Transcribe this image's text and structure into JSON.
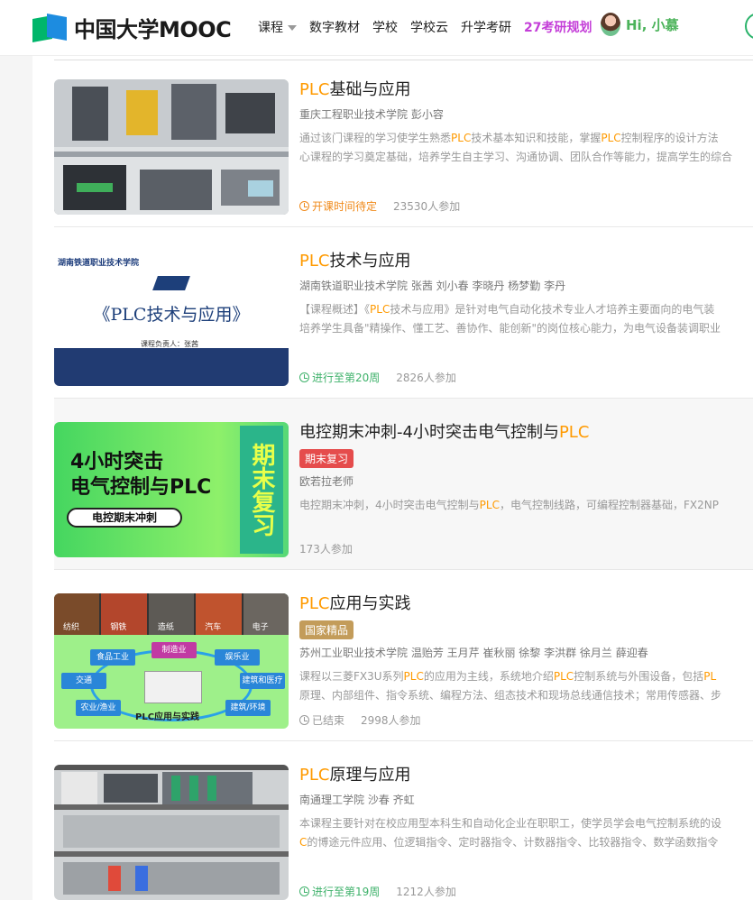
{
  "header": {
    "logo_text": "中国大学MOOC",
    "nav": [
      "课程",
      "数字教材",
      "学校",
      "学校云",
      "升学考研",
      "27考研规划"
    ],
    "greeting": "Hi, 小慕"
  },
  "courses": [
    {
      "title_hl": "PLC",
      "title_rest": "基础与应用",
      "tag": "",
      "school": "重庆工程职业技术学院   彭小容",
      "desc_line1": [
        "通过该门课程的学习使学生熟悉",
        "PLC",
        "技术基本知识和技能，掌握",
        "PLC",
        "控制程序的设计方法"
      ],
      "desc_line2": [
        "心课程的学习奠定基础，培养学生自主学习、沟通协调、团队合作等能力，提高学生的综合"
      ],
      "status": "开课时间待定",
      "status_type": "orange",
      "count": "23530人参加",
      "thumb": "machine"
    },
    {
      "title_hl": "PLC",
      "title_rest": "技术与应用",
      "tag": "",
      "school": "湖南铁道职业技术学院   张茜   刘小春   李晓丹   杨梦勤   李丹",
      "desc_line1": [
        "【课程概述】《",
        "PLC",
        "技术与应用》是针对电气自动化技术专业人才培养主要面向的电气装"
      ],
      "desc_line2": [
        "培养学生具备\"精操作、懂工艺、善协作、能创新\"的岗位核心能力，为电气设备装调职业"
      ],
      "status": "进行至第20周",
      "status_type": "green",
      "count": "2826人参加",
      "thumb": "cover",
      "thumb_title": "《PLC技术与应用》",
      "thumb_school": "湖南铁道职业技术学院",
      "thumb_person": "课程负责人：张茜"
    },
    {
      "title_pre": "电控期末冲刺-4小时突击电气控制与",
      "title_hl": "PLC",
      "tag": "期末复习",
      "tag_type": "red",
      "school": "欧若拉老师",
      "desc_line1": [
        "电控期末冲刺，4小时突击电气控制与",
        "PLC",
        "，电气控制线路，可编程控制器基础，FX2NP"
      ],
      "desc_line2": [],
      "status": "",
      "status_type": "none",
      "count": "173人参加",
      "thumb": "green",
      "thumb_line1": "4小时突击",
      "thumb_line2": "电气控制与PLC",
      "thumb_pill": "电控期末冲刺",
      "thumb_side": "期末复习"
    },
    {
      "title_hl": "PLC",
      "title_rest": "应用与实践",
      "tag": "国家精品",
      "tag_type": "gold",
      "school": "苏州工业职业技术学院   温贻芳   王月芹   崔秋丽   徐黎   李洪群   徐月兰   薛迎春",
      "desc_line1": [
        "课程以三菱FX3U系列",
        "PLC",
        "的应用为主线，系统地介绍",
        "PLC",
        "控制系统与外围设备，包括",
        "PL"
      ],
      "desc_line2": [
        "原理、内部组件、指令系统、编程方法、组态技术和现场总线通信技术；常用传感器、步"
      ],
      "status": "已结束",
      "status_type": "gray",
      "count": "2998人参加",
      "thumb": "diagram",
      "thumb_photos": [
        "纺织",
        "钢铁",
        "造纸",
        "汽车",
        "电子"
      ],
      "thumb_nodes": [
        "食品工业",
        "制造业",
        "娱乐业",
        "交通",
        "建筑和医疗",
        "农业/渔业",
        "建筑/环境"
      ],
      "thumb_caption": "PLC应用与实践"
    },
    {
      "title_hl": "PLC",
      "title_rest": "原理与应用",
      "tag": "",
      "school": "南通理工学院   沙春   齐虹",
      "desc_line1": [
        "本课程主要针对在校应用型本科生和自动化企业在职职工，使学员学会电气控制系统的设"
      ],
      "desc_line2": [
        "C",
        "的博途元件应用、位逻辑指令、定时器指令、计数器指令、比较器指令、数学函数指令"
      ],
      "status": "进行至第19周",
      "status_type": "green",
      "count": "1212人参加",
      "thumb": "panel"
    }
  ]
}
